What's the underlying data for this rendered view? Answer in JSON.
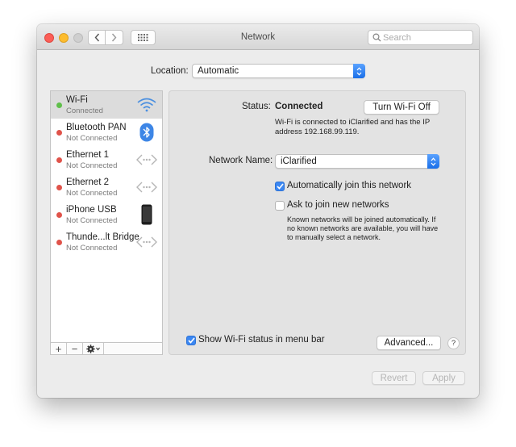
{
  "window": {
    "title": "Network"
  },
  "toolbar": {
    "search_placeholder": "Search"
  },
  "location": {
    "label": "Location:",
    "value": "Automatic"
  },
  "services": [
    {
      "name": "Wi-Fi",
      "status": "Connected",
      "status_color": "#5fbf4a",
      "icon": "wifi-icon",
      "selected": true
    },
    {
      "name": "Bluetooth PAN",
      "status": "Not Connected",
      "status_color": "#e0534a",
      "icon": "bluetooth-icon"
    },
    {
      "name": "Ethernet 1",
      "status": "Not Connected",
      "status_color": "#e0534a",
      "icon": "ethernet-icon"
    },
    {
      "name": "Ethernet 2",
      "status": "Not Connected",
      "status_color": "#e0534a",
      "icon": "ethernet-icon"
    },
    {
      "name": "iPhone USB",
      "status": "Not Connected",
      "status_color": "#e0534a",
      "icon": "iphone-icon"
    },
    {
      "name": "Thunde...lt Bridge",
      "status": "Not Connected",
      "status_color": "#e0534a",
      "icon": "ethernet-icon"
    }
  ],
  "sidebar_controls": {
    "add": "+",
    "remove": "−"
  },
  "detail": {
    "status_label": "Status:",
    "status_value": "Connected",
    "turn_off_label": "Turn Wi-Fi Off",
    "status_description": "Wi-Fi is connected to iClarified and has the IP address 192.168.99.119.",
    "network_name_label": "Network Name:",
    "network_name_value": "iClarified",
    "auto_join_label": "Automatically join this network",
    "auto_join_checked": true,
    "ask_join_label": "Ask to join new networks",
    "ask_join_checked": false,
    "ask_join_description": "Known networks will be joined automatically. If no known networks are available, you will have to manually select a network.",
    "show_status_label": "Show Wi-Fi status in menu bar",
    "show_status_checked": true,
    "advanced_label": "Advanced...",
    "help_label": "?"
  },
  "footer": {
    "revert_label": "Revert",
    "apply_label": "Apply"
  },
  "colors": {
    "accent": "#3b87f2",
    "connected": "#5fbf4a",
    "disconnected": "#e0534a"
  }
}
